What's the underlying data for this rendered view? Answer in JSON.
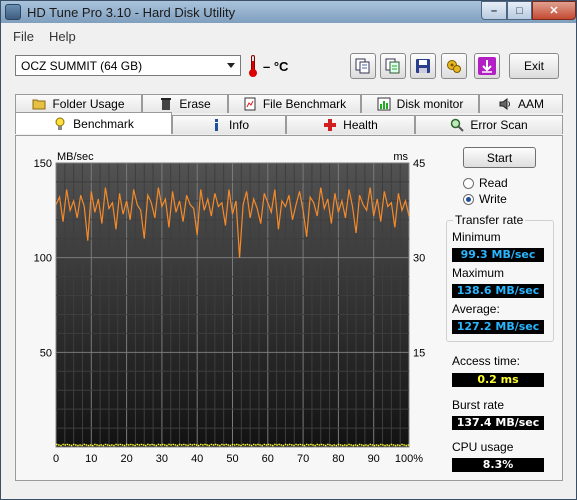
{
  "window": {
    "title": "HD Tune Pro 3.10 - Hard Disk Utility",
    "min_glyph": "–",
    "max_glyph": "□",
    "close_glyph": "✕"
  },
  "menu": {
    "file": "File",
    "help": "Help"
  },
  "toolbar": {
    "drive": "OCZ SUMMIT (64 GB)",
    "temperature": "– °C",
    "exit_label": "Exit"
  },
  "tabs_top": [
    {
      "label": "Folder Usage",
      "icon": "folder-icon"
    },
    {
      "label": "Erase",
      "icon": "trash-icon"
    },
    {
      "label": "File Benchmark",
      "icon": "file-benchmark-icon"
    },
    {
      "label": "Disk monitor",
      "icon": "disk-monitor-icon"
    },
    {
      "label": "AAM",
      "icon": "speaker-icon"
    }
  ],
  "tabs_bottom": [
    {
      "label": "Benchmark",
      "icon": "lightbulb-icon",
      "active": true
    },
    {
      "label": "Info",
      "icon": "info-icon"
    },
    {
      "label": "Health",
      "icon": "health-cross-icon"
    },
    {
      "label": "Error Scan",
      "icon": "magnifier-icon"
    }
  ],
  "controls": {
    "start": "Start",
    "read": "Read",
    "write": "Write",
    "selected_mode": "Write"
  },
  "results": {
    "transfer_rate_title": "Transfer rate",
    "minimum_label": "Minimum",
    "minimum_value": "99.3 MB/sec",
    "maximum_label": "Maximum",
    "maximum_value": "138.6 MB/sec",
    "average_label": "Average:",
    "average_value": "127.2 MB/sec",
    "access_label": "Access time:",
    "access_value": "0.2 ms",
    "burst_label": "Burst rate",
    "burst_value": "137.4 MB/sec",
    "cpu_label": "CPU usage",
    "cpu_value": "8.3%"
  },
  "colors": {
    "transfer_line": "#f58a2a",
    "access_dots": "#ffff33",
    "value_blue": "#29b6ff",
    "value_yellow": "#ffff2e"
  },
  "chart_data": {
    "type": "line",
    "ylabel_left": "MB/sec",
    "ylabel_right": "ms",
    "ylim_left": [
      0,
      150
    ],
    "ylim_right": [
      0,
      45
    ],
    "xlim": [
      0,
      100
    ],
    "x_ticks": [
      "0",
      "10",
      "20",
      "30",
      "40",
      "50",
      "60",
      "70",
      "80",
      "90",
      "100%"
    ],
    "y_ticks_left": [
      "150",
      "100",
      "50"
    ],
    "y_ticks_right": [
      "45",
      "30",
      "15"
    ],
    "grid": true,
    "series": [
      {
        "name": "transfer rate",
        "axis": "left",
        "x": [
          0,
          1,
          2,
          3,
          4,
          5,
          6,
          7,
          8,
          9,
          10,
          11,
          12,
          13,
          14,
          15,
          16,
          17,
          18,
          19,
          20,
          21,
          22,
          23,
          24,
          25,
          26,
          27,
          28,
          29,
          30,
          31,
          32,
          33,
          34,
          35,
          36,
          37,
          38,
          39,
          40,
          41,
          42,
          43,
          44,
          45,
          46,
          47,
          48,
          49,
          50,
          51,
          52,
          53,
          54,
          55,
          56,
          57,
          58,
          59,
          60,
          61,
          62,
          63,
          64,
          65,
          66,
          67,
          68,
          69,
          70,
          71,
          72,
          73,
          74,
          75,
          76,
          77,
          78,
          79,
          80,
          81,
          82,
          83,
          84,
          85,
          86,
          87,
          88,
          89,
          90,
          91,
          92,
          93,
          94,
          95,
          96,
          97,
          98,
          99,
          100
        ],
        "values": [
          128,
          132,
          119,
          136,
          125,
          130,
          121,
          133,
          127,
          109,
          135,
          124,
          131,
          118,
          137,
          126,
          129,
          115,
          134,
          123,
          130,
          120,
          136,
          128,
          125,
          110,
          133,
          129,
          121,
          137,
          127,
          131,
          116,
          135,
          124,
          130,
          119,
          133,
          128,
          126,
          112,
          136,
          125,
          131,
          122,
          134,
          127,
          129,
          117,
          136,
          123,
          130,
          100,
          128,
          135,
          121,
          131,
          126,
          118,
          134,
          129,
          124,
          136,
          115,
          130,
          127,
          133,
          120,
          128,
          135,
          125,
          111,
          132,
          129,
          122,
          137,
          126,
          131,
          118,
          134,
          124,
          130,
          121,
          136,
          127,
          113,
          133,
          128,
          125,
          137,
          122,
          131,
          119,
          135,
          127,
          129,
          116,
          134,
          125,
          130,
          122
        ]
      },
      {
        "name": "access time",
        "axis": "right",
        "values_constant": 0.2
      }
    ]
  }
}
